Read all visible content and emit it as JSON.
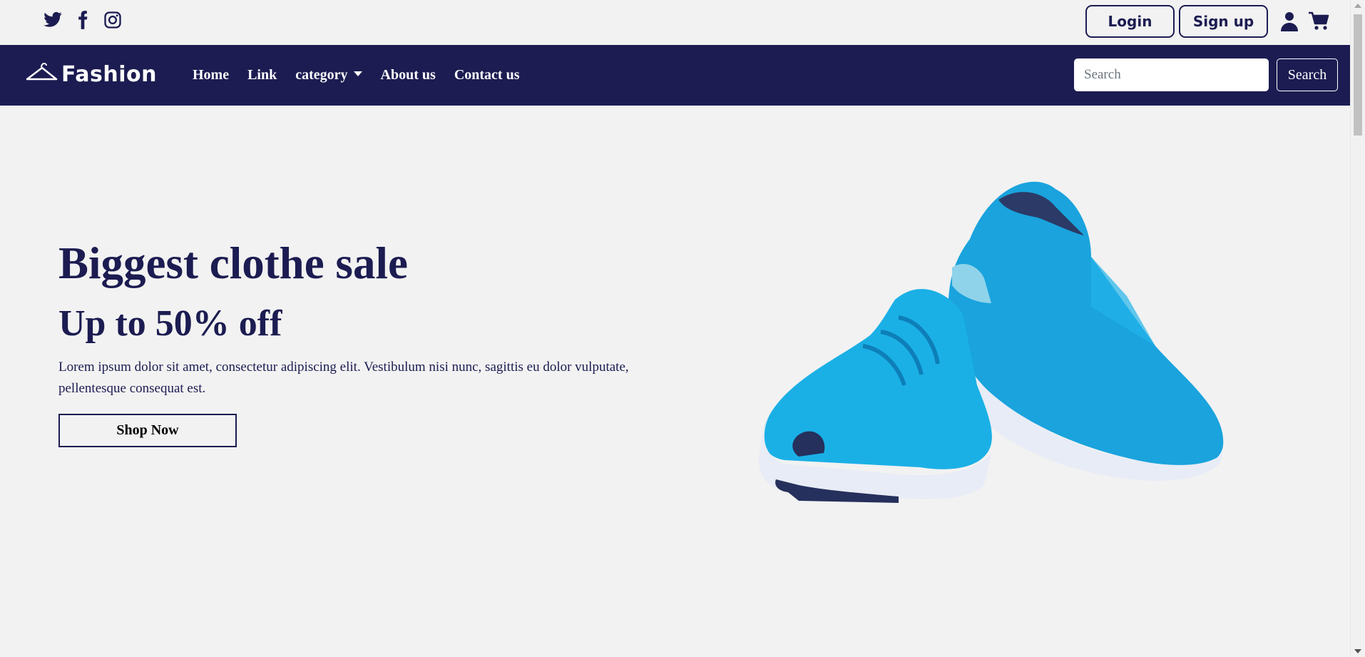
{
  "social": {
    "icons": [
      "twitter-icon",
      "facebook-icon",
      "instagram-icon"
    ]
  },
  "auth": {
    "login_label": "Login",
    "signup_label": "Sign up",
    "icons": [
      "user-icon",
      "cart-icon"
    ]
  },
  "brand": {
    "name": "Fashion",
    "icon": "hanger-icon"
  },
  "nav": {
    "home": "Home",
    "link": "Link",
    "category": "category",
    "about": "About us",
    "contact": "Contact us"
  },
  "search": {
    "placeholder": "Search",
    "button_label": "Search"
  },
  "hero": {
    "title": "Biggest clothe sale",
    "subtitle": "Up to 50% off",
    "description": "Lorem ipsum dolor sit amet, consectetur adipiscing elit. Vestibulum nisi nunc, sagittis eu dolor vulputate, pellentesque consequat est.",
    "button_label": "Shop Now",
    "image": "blue-running-sneakers"
  },
  "colors": {
    "primary": "#1c1c52",
    "background": "#f2f2f2",
    "accent": "#1aa3dd"
  }
}
